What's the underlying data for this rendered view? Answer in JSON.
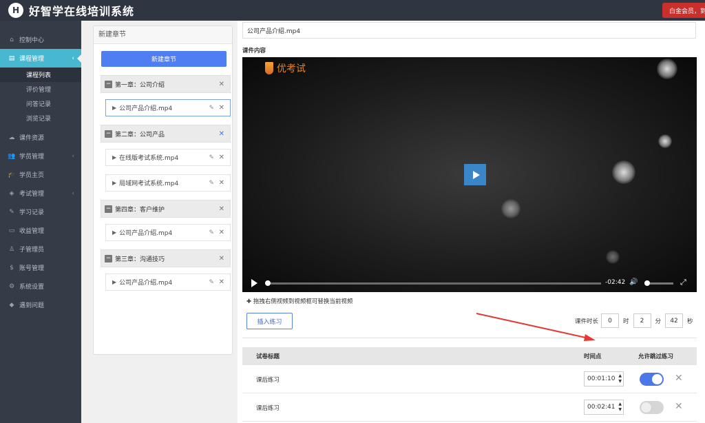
{
  "app": {
    "title": "好智学在线培训系统",
    "logo_letter": "H",
    "vip_badge": "白金会员，到"
  },
  "sidebar": {
    "items": [
      {
        "label": "控制中心",
        "icon": "home-icon"
      },
      {
        "label": "课程管理",
        "icon": "book-icon",
        "active": true
      },
      {
        "label": "课件资源",
        "icon": "cloud-icon"
      },
      {
        "label": "学员管理",
        "icon": "users-icon",
        "arrow": true
      },
      {
        "label": "学员主页",
        "icon": "graduation-icon"
      },
      {
        "label": "考试管理",
        "icon": "tag-icon",
        "arrow": true
      },
      {
        "label": "学习记录",
        "icon": "pencil-icon"
      },
      {
        "label": "收益管理",
        "icon": "card-icon"
      },
      {
        "label": "子管理员",
        "icon": "user-icon"
      },
      {
        "label": "账号管理",
        "icon": "dollar-icon"
      },
      {
        "label": "系统设置",
        "icon": "gear-icon"
      },
      {
        "label": "遇到问题",
        "icon": "diamond-icon"
      }
    ],
    "sub_items": [
      "课程列表",
      "评价管理",
      "问答记录",
      "浏览记录"
    ]
  },
  "chapters": {
    "panel_title": "新建章节",
    "new_button": "新建章节",
    "list": [
      {
        "title": "第一章：公司介绍",
        "lessons": [
          "公司产品介绍.mp4"
        ]
      },
      {
        "title": "第二章：公司产品",
        "lessons": [
          "在线版考试系统.mp4",
          "局域网考试系统.mp4"
        ]
      },
      {
        "title": "第四章：客户维护",
        "lessons": [
          "公司产品介绍.mp4"
        ]
      },
      {
        "title": "第三章：沟通技巧",
        "lessons": [
          "公司产品介绍.mp4"
        ]
      }
    ]
  },
  "content": {
    "filename": "公司产品介绍.mp4",
    "section_label": "课件内容",
    "video": {
      "brand": "优考试",
      "time_remaining": "-02:42"
    },
    "drag_hint": "✚ 拖拽右侧视频到视频框可替换当前视频",
    "insert_button": "插入练习",
    "duration": {
      "label": "课件时长",
      "hours": "0",
      "hours_unit": "时",
      "minutes": "2",
      "minutes_unit": "分",
      "seconds": "42",
      "seconds_unit": "秒"
    },
    "table": {
      "headers": [
        "试卷标题",
        "时间点",
        "允许跳过练习"
      ],
      "rows": [
        {
          "title": "课后练习",
          "time": "00:01:10",
          "allow_skip": true
        },
        {
          "title": "课后练习",
          "time": "00:02:41",
          "allow_skip": false
        }
      ]
    }
  },
  "colors": {
    "sidebar_bg": "#353c48",
    "active": "#48b8d0",
    "primary": "#4f7ef2",
    "badge": "#c9302c",
    "annotation_arrow": "#e53935"
  }
}
